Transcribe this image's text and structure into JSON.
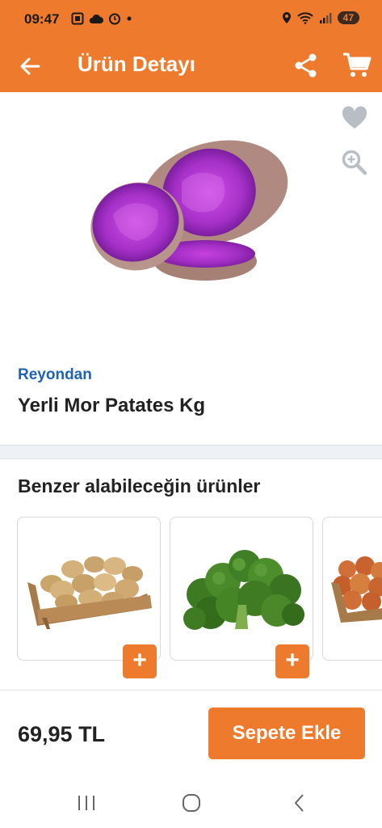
{
  "status": {
    "time": "09:47",
    "battery": "47",
    "left_icons": [
      "screenshot-icon",
      "cloud-icon",
      "alarm-icon",
      "dot-icon"
    ],
    "right_icons": [
      "location-icon",
      "wifi-icon",
      "signal-icon"
    ]
  },
  "appbar": {
    "title": "Ürün Detayı",
    "back_icon": "arrow-left-icon",
    "share_icon": "share-icon",
    "cart_icon": "cart-icon"
  },
  "product": {
    "brand": "Reyondan",
    "name": "Yerli Mor Patates Kg",
    "image": "purple-potato-image",
    "price": "69,95 TL"
  },
  "similar": {
    "title": "Benzer alabileceğin ürünler",
    "items": [
      {
        "image": "potatoes-crate-image"
      },
      {
        "image": "broccoli-image"
      },
      {
        "image": "onions-crate-image"
      }
    ],
    "add_label": "+"
  },
  "actions": {
    "add_to_cart": "Sepete Ekle"
  },
  "colors": {
    "primary": "#ee7b2d",
    "link": "#1f64b3",
    "text": "#222222"
  }
}
